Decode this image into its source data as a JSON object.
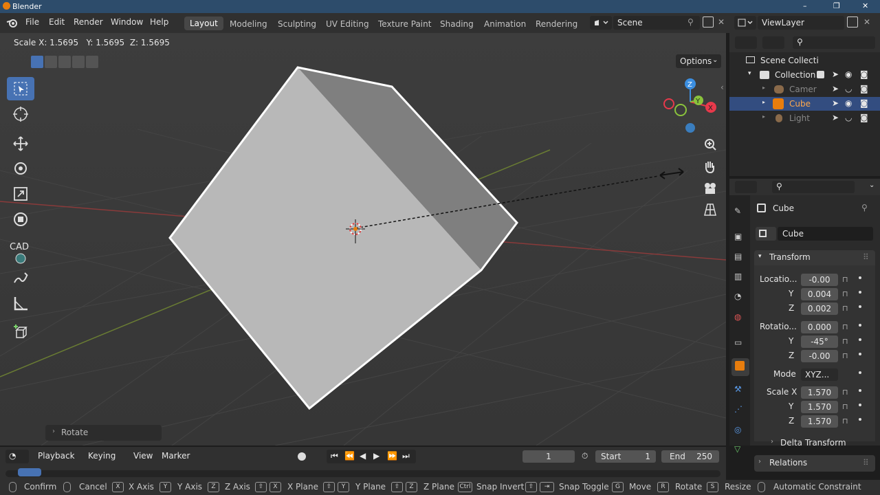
{
  "window": {
    "title": "Blender",
    "min": "–",
    "max": "❐",
    "close": "✕"
  },
  "menu": {
    "file": "File",
    "edit": "Edit",
    "render": "Render",
    "window": "Window",
    "help": "Help"
  },
  "workspaces": [
    "Layout",
    "Modeling",
    "Sculpting",
    "UV Editing",
    "Texture Paint",
    "Shading",
    "Animation",
    "Rendering"
  ],
  "scene": {
    "name": "Scene",
    "viewlayer": "ViewLayer"
  },
  "viewport": {
    "header_text": "Scale X: 1.5695   Y: 1.5695  Z: 1.5695",
    "options_label": "Options",
    "cad_label": "CAD",
    "operator_panel": "Rotate",
    "gizmo": {
      "z": "Z",
      "y": "Y",
      "x": "X"
    }
  },
  "outliner": {
    "items": [
      {
        "label": "Scene Collecti",
        "kind": "scene-collection"
      },
      {
        "label": "Collection",
        "kind": "collection"
      },
      {
        "label": "Camer",
        "kind": "camera"
      },
      {
        "label": "Cube",
        "kind": "mesh",
        "selected": true
      },
      {
        "label": "Light",
        "kind": "light"
      }
    ]
  },
  "properties": {
    "object_name": "Cube",
    "data_name": "Cube",
    "transform_header": "Transform",
    "location_label": "Locatio...",
    "location": {
      "x": "-0.00",
      "y": "0.004",
      "z": "0.002"
    },
    "rotation_label": "Rotatio...",
    "rotation": {
      "x": "0.000",
      "y": "-45°",
      "z": "-0.00"
    },
    "mode_label": "Mode",
    "mode_value": "XYZ...",
    "scale_label": "Scale X",
    "scale": {
      "x": "1.570",
      "y": "1.570",
      "z": "1.570"
    },
    "axis_y": "Y",
    "axis_z": "Z",
    "delta_transform": "Delta Transform",
    "relations": "Relations"
  },
  "timeline": {
    "playback": "Playback",
    "keying": "Keying",
    "view": "View",
    "marker": "Marker",
    "current_frame": "1",
    "start_label": "Start",
    "start": "1",
    "end_label": "End",
    "end": "250"
  },
  "statusbar": {
    "confirm": "Confirm",
    "cancel": "Cancel",
    "x_key": "X",
    "x_axis": "X Axis",
    "y_key": "Y",
    "y_axis": "Y Axis",
    "z_key": "Z",
    "z_axis": "Z Axis",
    "x_plane": "X Plane",
    "y_plane": "Y Plane",
    "z_plane": "Z Plane",
    "ctrl_key": "Ctrl",
    "snap_invert": "Snap Invert",
    "snap_toggle": "Snap Toggle",
    "g_key": "G",
    "move": "Move",
    "r_key": "R",
    "rotate": "Rotate",
    "s_key": "S",
    "resize": "Resize",
    "auto_constraint": "Automatic Constraint"
  },
  "colors": {
    "accent": "#4772b3",
    "selection": "#e87d0d",
    "axis_x": "#e8394b",
    "axis_y": "#8ac33c",
    "axis_z": "#3b8ee0"
  }
}
